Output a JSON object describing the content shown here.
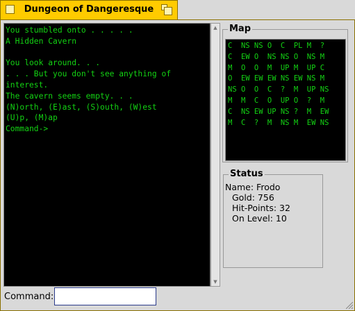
{
  "window": {
    "title": "Dungeon of Dangeresque"
  },
  "terminal": {
    "lines": [
      "You stumbled onto . . . . .",
      "A Hidden Cavern",
      "",
      "You look around. . .",
      ". . . But you don't see anything of",
      "interest.",
      "The cavern seems empty. . .",
      "(N)orth, (E)ast, (S)outh, (W)est",
      "(U)p, (M)ap",
      "Command->"
    ]
  },
  "map": {
    "label": "Map",
    "rows": [
      "C  NS NS O  C  PL M  ?",
      "C  EW O  NS NS O  NS M",
      "M  O  O  M  UP M  UP C",
      "O  EW EW EW NS EW NS M",
      "NS O  O  C  ?  M  UP NS",
      "M  M  C  O  UP O  ?  M",
      "C  NS EW UP NS ?  M  EW",
      "M  C  ?  M  NS M  EW NS"
    ]
  },
  "status": {
    "label": "Status",
    "name": "Name: Frodo",
    "gold": "Gold: 756",
    "hit_points": "Hit-Points: 32",
    "level": "On Level: 10"
  },
  "command": {
    "label": "Command:",
    "value": ""
  },
  "colors": {
    "terminal_fg": "#13d313",
    "tab": "#ffcb00"
  }
}
